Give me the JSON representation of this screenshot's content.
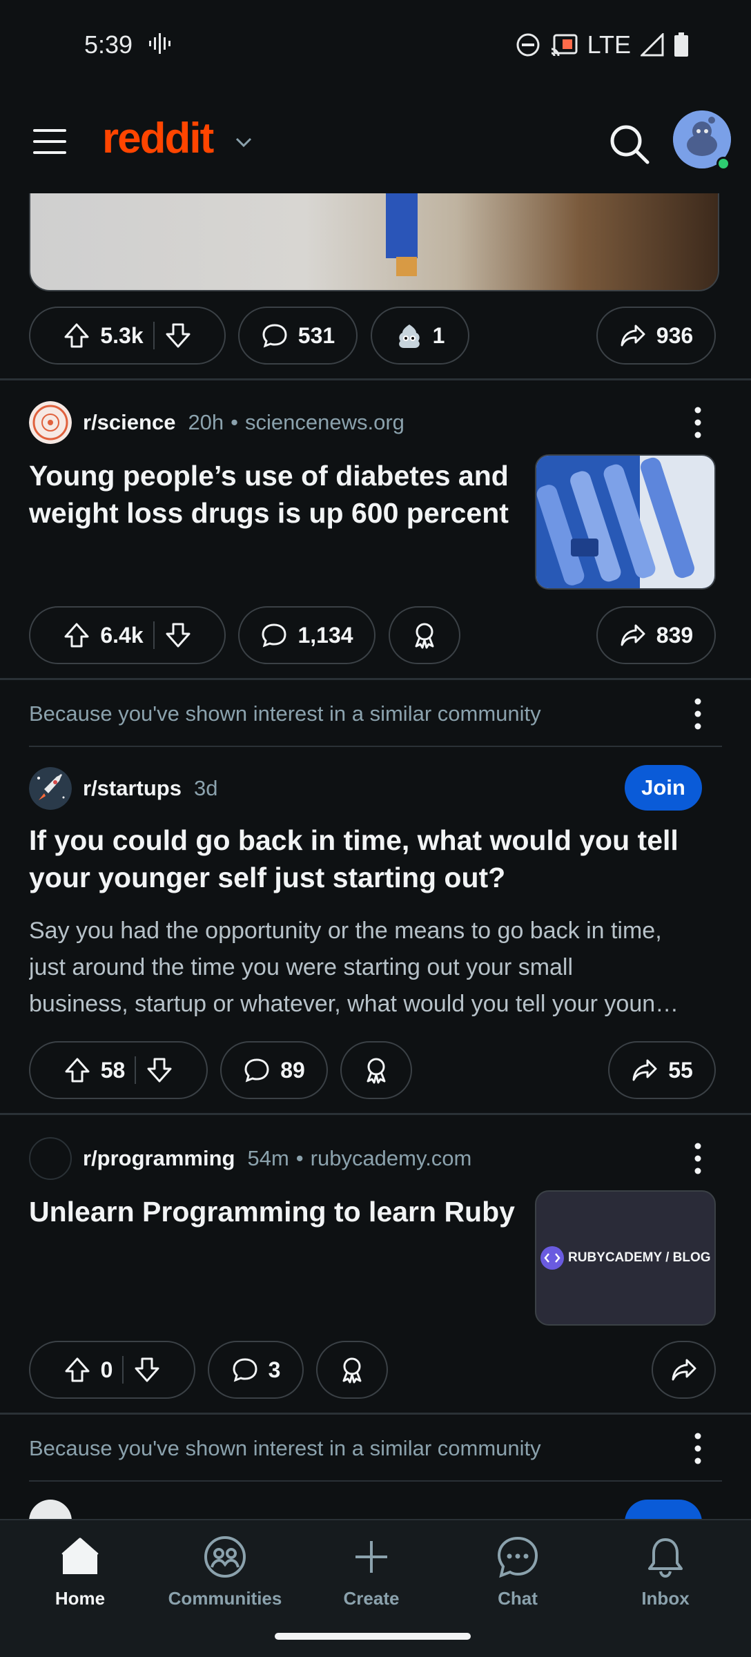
{
  "status": {
    "time": "5:39",
    "network": "LTE"
  },
  "app": {
    "logo": "reddit"
  },
  "posts": [
    {
      "votes": "5.3k",
      "comments": "531",
      "award_count": "1",
      "shares": "936"
    },
    {
      "subreddit": "r/science",
      "age": "20h",
      "domain": "sciencenews.org",
      "title_line1": "Young people’s use of diabetes and",
      "title_line2": "weight loss drugs is up 600 percent",
      "votes": "6.4k",
      "comments": "1,134",
      "shares": "839"
    },
    {
      "recommendation": "Because you've shown interest in a similar community",
      "subreddit": "r/startups",
      "age": "3d",
      "join_label": "Join",
      "title_line1": "If you could go back in time, what would you tell",
      "title_line2": "your younger self just starting out?",
      "body_line1": "Say you had the opportunity or the means to go back in time,",
      "body_line2": "just around the time you were starting out your small",
      "body_line3": "business, startup or whatever, what would you tell your youn…",
      "votes": "58",
      "comments": "89",
      "shares": "55"
    },
    {
      "subreddit": "r/programming",
      "age": "54m",
      "domain": "rubycademy.com",
      "title_line1": "Unlearn Programming to learn Ruby",
      "thumb_text": "RUBYCADEMY / BLOG",
      "votes": "0",
      "comments": "3"
    },
    {
      "recommendation": "Because you've shown interest in a similar community"
    }
  ],
  "nav": [
    {
      "label": "Home",
      "icon": "home-icon",
      "active": true
    },
    {
      "label": "Communities",
      "icon": "communities-icon"
    },
    {
      "label": "Create",
      "icon": "plus-icon"
    },
    {
      "label": "Chat",
      "icon": "chat-icon"
    },
    {
      "label": "Inbox",
      "icon": "bell-icon"
    }
  ]
}
